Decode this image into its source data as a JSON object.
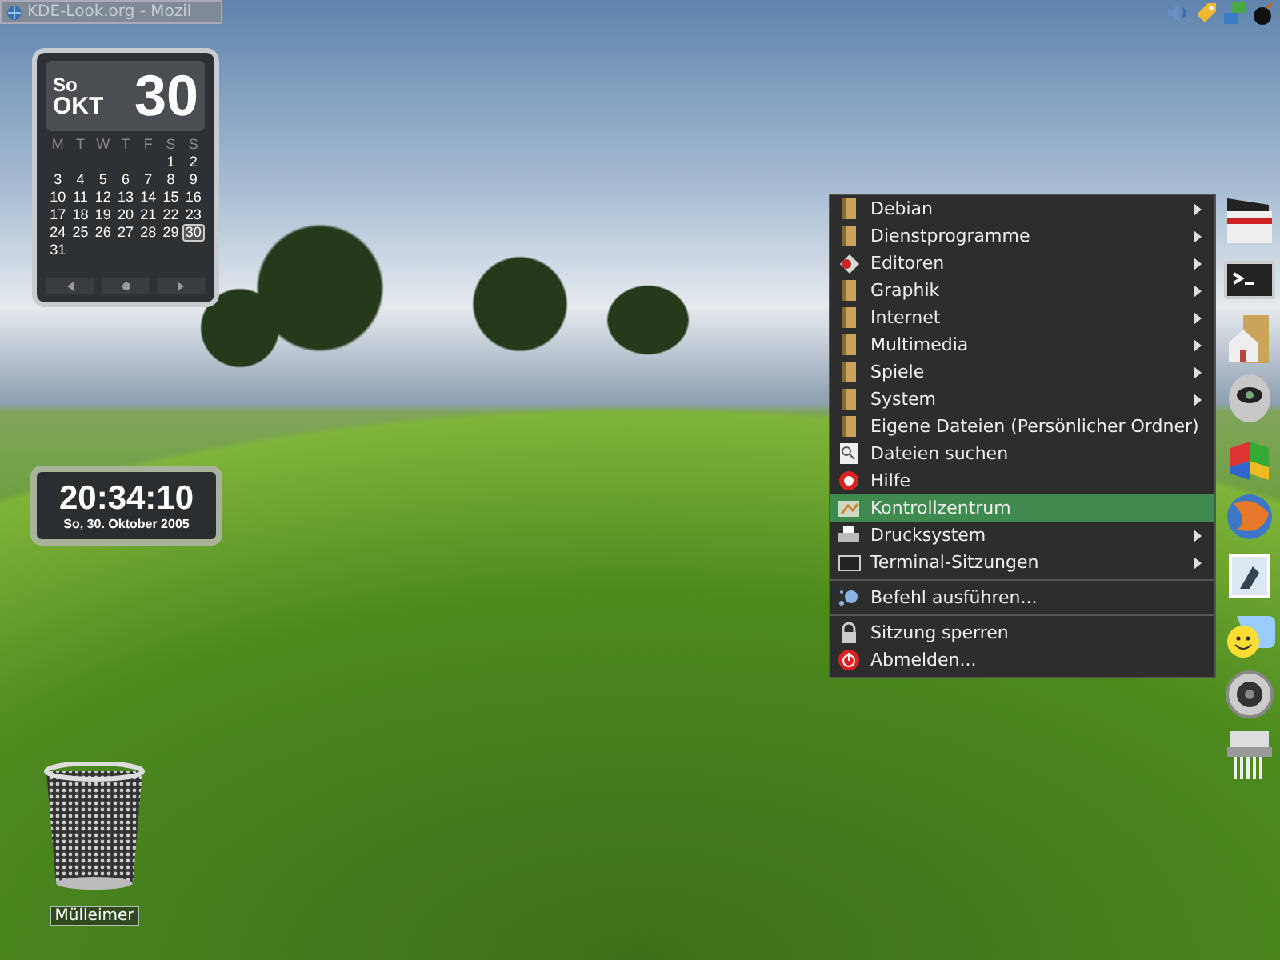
{
  "taskbar": {
    "title": "KDE-Look.org - Mozil"
  },
  "calendar": {
    "weekday": "So",
    "month": "OKT",
    "day": "30",
    "weekdays": [
      "M",
      "T",
      "W",
      "T",
      "F",
      "S",
      "S"
    ],
    "weeks": [
      {
        "days": [
          {
            "label": "1",
            "selected": false
          },
          {
            "label": "2",
            "selected": false
          }
        ]
      },
      {
        "days": [
          {
            "label": "3",
            "selected": false
          },
          {
            "label": "4",
            "selected": false
          },
          {
            "label": "5",
            "selected": false
          },
          {
            "label": "6",
            "selected": false
          },
          {
            "label": "7",
            "selected": false
          },
          {
            "label": "8",
            "selected": false
          },
          {
            "label": "9",
            "selected": false
          }
        ]
      },
      {
        "days": [
          {
            "label": "10",
            "selected": false
          },
          {
            "label": "11",
            "selected": false
          },
          {
            "label": "12",
            "selected": false
          },
          {
            "label": "13",
            "selected": false
          },
          {
            "label": "14",
            "selected": false
          },
          {
            "label": "15",
            "selected": false
          },
          {
            "label": "16",
            "selected": false
          }
        ]
      },
      {
        "days": [
          {
            "label": "17",
            "selected": false
          },
          {
            "label": "18",
            "selected": false
          },
          {
            "label": "19",
            "selected": false
          },
          {
            "label": "20",
            "selected": false
          },
          {
            "label": "21",
            "selected": false
          },
          {
            "label": "22",
            "selected": false
          },
          {
            "label": "23",
            "selected": false
          }
        ]
      },
      {
        "days": [
          {
            "label": "24",
            "selected": false
          },
          {
            "label": "25",
            "selected": false
          },
          {
            "label": "26",
            "selected": false
          },
          {
            "label": "27",
            "selected": false
          },
          {
            "label": "28",
            "selected": false
          },
          {
            "label": "29",
            "selected": false
          },
          {
            "label": "30",
            "selected": true
          }
        ]
      },
      {
        "days": [
          {
            "label": "31",
            "selected": false
          }
        ]
      }
    ]
  },
  "clock": {
    "time": "20:34:10",
    "date": "So, 30. Oktober 2005"
  },
  "menu": {
    "items": [
      {
        "kind": "folder",
        "label": "Debian",
        "submenu": true,
        "selected": false
      },
      {
        "kind": "folder",
        "label": "Dienstprogramme",
        "submenu": true,
        "selected": false
      },
      {
        "kind": "editor",
        "label": "Editoren",
        "submenu": true,
        "selected": false
      },
      {
        "kind": "folder",
        "label": "Graphik",
        "submenu": true,
        "selected": false
      },
      {
        "kind": "folder",
        "label": "Internet",
        "submenu": true,
        "selected": false
      },
      {
        "kind": "folder",
        "label": "Multimedia",
        "submenu": true,
        "selected": false
      },
      {
        "kind": "folder",
        "label": "Spiele",
        "submenu": true,
        "selected": false
      },
      {
        "kind": "folder",
        "label": "System",
        "submenu": true,
        "selected": false
      },
      {
        "kind": "folder",
        "label": "Eigene Dateien (Persönlicher Ordner)",
        "submenu": false,
        "selected": false
      },
      {
        "kind": "search",
        "label": "Dateien suchen",
        "submenu": false,
        "selected": false
      },
      {
        "kind": "help",
        "label": "Hilfe",
        "submenu": false,
        "selected": false
      },
      {
        "kind": "control",
        "label": "Kontrollzentrum",
        "submenu": false,
        "selected": true
      },
      {
        "kind": "printer",
        "label": "Drucksystem",
        "submenu": true,
        "selected": false
      },
      {
        "kind": "terminal",
        "label": "Terminal-Sitzungen",
        "submenu": true,
        "selected": false
      },
      {
        "kind": "separator"
      },
      {
        "kind": "run",
        "label": "Befehl ausführen...",
        "submenu": false,
        "selected": false
      },
      {
        "kind": "separator"
      },
      {
        "kind": "lock",
        "label": "Sitzung sperren",
        "submenu": false,
        "selected": false
      },
      {
        "kind": "logout",
        "label": "Abmelden...",
        "submenu": false,
        "selected": false
      }
    ]
  },
  "trash": {
    "label": "Mülleimer"
  }
}
